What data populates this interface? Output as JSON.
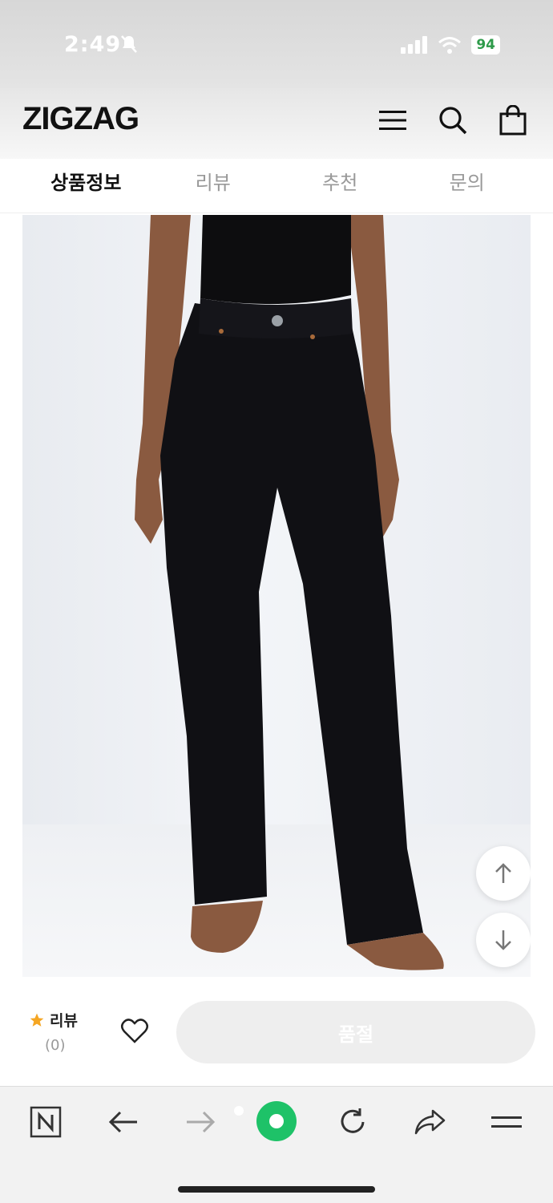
{
  "status_bar": {
    "time": "2:49",
    "battery": "94"
  },
  "header": {
    "logo": "ZIGZAG"
  },
  "tabs": [
    {
      "label": "상품정보",
      "active": true
    },
    {
      "label": "리뷰",
      "active": false
    },
    {
      "label": "추천",
      "active": false
    },
    {
      "label": "문의",
      "active": false
    }
  ],
  "action_bar": {
    "review_label": "리뷰",
    "review_count": "(0)",
    "soldout_label": "품절"
  },
  "colors": {
    "accent_star": "#f5a623",
    "soldout_bg": "#eeeeee",
    "green_accent": "#1ec268",
    "battery_text": "#2e9b4a"
  }
}
